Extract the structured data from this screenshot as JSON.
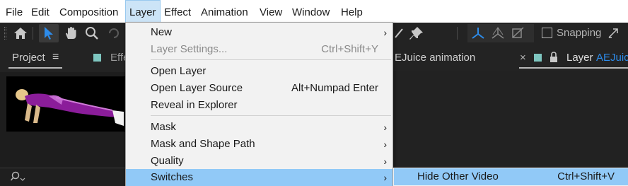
{
  "menubar": {
    "items": [
      "File",
      "Edit",
      "Composition",
      "Layer",
      "Effect",
      "Animation",
      "View",
      "Window",
      "Help"
    ],
    "active": "Layer"
  },
  "toolbar": {
    "snapping_label": "Snapping",
    "icons": [
      "home-icon",
      "selection-tool-icon",
      "hand-tool-icon",
      "zoom-tool-icon",
      "rotate-tool-icon",
      "puppet-pin-icon",
      "axis-local-icon",
      "axis-world-icon",
      "axis-view-icon",
      "snapping-checkbox",
      "snapping-expand-icon"
    ]
  },
  "project_panel": {
    "tab_label": "Project",
    "menu_glyph": "≡",
    "effects_tab_partial": "Effe",
    "search_icon": "search-icon"
  },
  "comp_panel": {
    "tab_partial": "EJuice animation",
    "layer_tab_label": "Layer",
    "layer_tab_name": "AEJuice",
    "close_glyph": "×"
  },
  "layer_menu": {
    "items": [
      {
        "label": "New",
        "shortcut": "",
        "submenu": true,
        "disabled": false
      },
      {
        "label": "Layer Settings...",
        "shortcut": "Ctrl+Shift+Y",
        "submenu": false,
        "disabled": true
      },
      {
        "label": "Open Layer",
        "shortcut": "",
        "submenu": false,
        "disabled": false
      },
      {
        "label": "Open Layer Source",
        "shortcut": "Alt+Numpad Enter",
        "submenu": false,
        "disabled": false
      },
      {
        "label": "Reveal in Explorer",
        "shortcut": "",
        "submenu": false,
        "disabled": false
      },
      {
        "label": "Mask",
        "shortcut": "",
        "submenu": true,
        "disabled": false
      },
      {
        "label": "Mask and Shape Path",
        "shortcut": "",
        "submenu": true,
        "disabled": false
      },
      {
        "label": "Quality",
        "shortcut": "",
        "submenu": true,
        "disabled": false
      },
      {
        "label": "Switches",
        "shortcut": "",
        "submenu": true,
        "disabled": false,
        "highlighted": true
      }
    ],
    "submenu_arrow": "›"
  },
  "switches_submenu": {
    "items": [
      {
        "label": "Hide Other Video",
        "shortcut": "Ctrl+Shift+V",
        "highlighted": true
      }
    ]
  },
  "colors": {
    "menu_highlight": "#91c9f7",
    "app_background": "#232323",
    "tool_active_blue": "#2d8ceb",
    "layer_name_blue": "#2d8ceb",
    "label_teal": "#7ec6c0"
  }
}
